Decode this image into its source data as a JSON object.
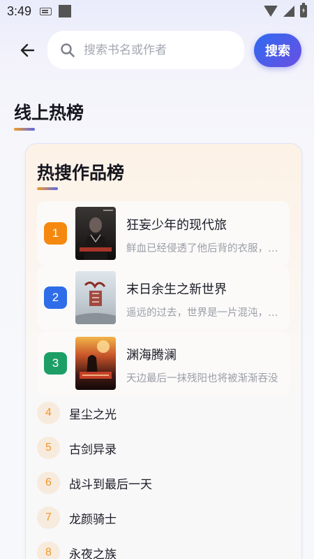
{
  "status_bar": {
    "time": "3:49",
    "icons": [
      "keyboard-icon",
      "square-icon",
      "wifi-icon",
      "signal-icon",
      "battery-icon"
    ]
  },
  "header": {
    "back_icon": "back-arrow-icon",
    "search_icon": "search-icon",
    "search_placeholder": "搜索书名或作者",
    "search_value": "",
    "search_button_label": "搜索"
  },
  "section": {
    "title": "线上热榜"
  },
  "hot_list": {
    "title": "热搜作品榜",
    "top_items": [
      {
        "rank": "1",
        "name": "狂妄少年的现代旅",
        "desc": "鲜血已经侵透了他后背的衣服，整个人",
        "badge_color": "#f5890f"
      },
      {
        "rank": "2",
        "name": "末日余生之新世界",
        "desc": "遥远的过去，世界是一片混沌，天地",
        "badge_color": "#2f6de8"
      },
      {
        "rank": "3",
        "name": "渊海腾澜",
        "desc": "天边最后一抹残阳也将被渐渐吞没",
        "badge_color": "#1e9e67"
      }
    ],
    "other_items": [
      {
        "rank": "4",
        "name": "星尘之光"
      },
      {
        "rank": "5",
        "name": "古剑异录"
      },
      {
        "rank": "6",
        "name": "战斗到最后一天"
      },
      {
        "rank": "7",
        "name": "龙颜骑士"
      },
      {
        "rank": "8",
        "name": "永夜之族"
      }
    ]
  },
  "colors": {
    "accent_orange": "#f39a26",
    "accent_blue": "#2f6bf0",
    "accent_purple": "#6a4fe3",
    "small_rank_bg": "#f7ebdd"
  }
}
